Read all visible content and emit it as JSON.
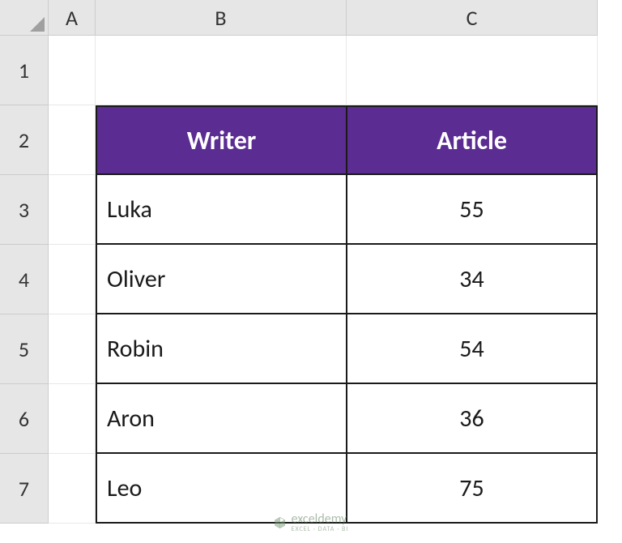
{
  "columns": [
    "A",
    "B",
    "C"
  ],
  "rows": [
    "1",
    "2",
    "3",
    "4",
    "5",
    "6",
    "7"
  ],
  "table": {
    "headers": {
      "writer": "Writer",
      "article": "Article"
    },
    "data": [
      {
        "writer": "Luka",
        "article": "55"
      },
      {
        "writer": "Oliver",
        "article": "34"
      },
      {
        "writer": "Robin",
        "article": "54"
      },
      {
        "writer": "Aron",
        "article": "36"
      },
      {
        "writer": "Leo",
        "article": "75"
      }
    ]
  },
  "watermark": {
    "brand": "exceldemy",
    "tagline": "EXCEL · DATA · BI"
  },
  "chart_data": {
    "type": "table",
    "title": "",
    "columns": [
      "Writer",
      "Article"
    ],
    "rows": [
      [
        "Luka",
        55
      ],
      [
        "Oliver",
        34
      ],
      [
        "Robin",
        54
      ],
      [
        "Aron",
        36
      ],
      [
        "Leo",
        75
      ]
    ]
  }
}
